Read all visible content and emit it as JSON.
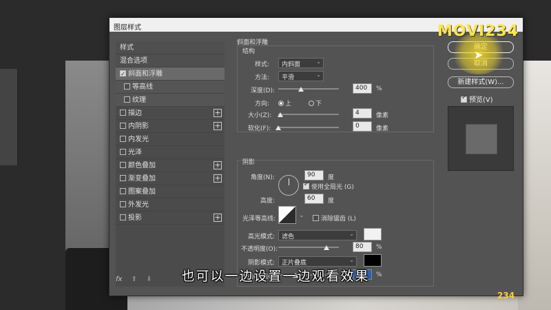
{
  "dialog": {
    "title": "图层样式"
  },
  "style_list": {
    "items": [
      {
        "label": "样式",
        "type": "head"
      },
      {
        "label": "混合选项",
        "type": "head"
      },
      {
        "label": "斜面和浮雕",
        "checked": true,
        "active": true
      },
      {
        "label": "等高线",
        "sub": true
      },
      {
        "label": "纹理",
        "sub": true
      },
      {
        "label": "描边",
        "plus": true
      },
      {
        "label": "内阴影",
        "plus": true
      },
      {
        "label": "内发光"
      },
      {
        "label": "光泽"
      },
      {
        "label": "颜色叠加",
        "plus": true
      },
      {
        "label": "渐变叠加",
        "plus": true
      },
      {
        "label": "图案叠加"
      },
      {
        "label": "外发光"
      },
      {
        "label": "投影",
        "plus": true
      }
    ],
    "footer": {
      "fx": "fx",
      "up": "⬆",
      "down": "⬇",
      "trash": "🗑"
    }
  },
  "bevel": {
    "section_title": "斜面和浮雕",
    "structure_title": "结构",
    "style_label": "样式:",
    "style_value": "内斜面",
    "technique_label": "方法:",
    "technique_value": "平滑",
    "depth_label": "深度(D):",
    "depth_value": "400",
    "depth_unit": "%",
    "depth_level": 0.35,
    "direction_label": "方向:",
    "direction_up": "上",
    "direction_down": "下",
    "size_label": "大小(Z):",
    "size_value": "4",
    "size_unit": "像素",
    "soften_label": "软化(F):",
    "soften_value": "0",
    "soften_unit": "像素"
  },
  "shading": {
    "title": "阴影",
    "angle_label": "角度(N):",
    "angle_value": "90",
    "angle_unit": "度",
    "global_light_label": "使用全局光 (G)",
    "altitude_label": "高度:",
    "altitude_value": "60",
    "altitude_unit": "度",
    "gloss_contour_label": "光泽等高线:",
    "anti_alias_label": "消除锯齿 (L)",
    "highlight_mode_label": "高光模式:",
    "highlight_mode_value": "滤色",
    "highlight_opacity_label": "不透明度(O):",
    "highlight_opacity_value": "80",
    "highlight_opacity_unit": "%",
    "shadow_mode_label": "阴影模式:",
    "shadow_mode_value": "正片叠底",
    "shadow_opacity_label": "不透明度(C):",
    "shadow_opacity_value": "28",
    "shadow_opacity_unit": "%",
    "highlight_color": "#f2f2f2",
    "shadow_color": "#000000"
  },
  "buttons": {
    "ok": "确定",
    "cancel": "取消",
    "new_style": "新建样式(W)...",
    "preview": "预览(V)"
  },
  "logo": {
    "text": "MOVI234",
    "small": "234"
  },
  "subtitle": "也可以一边设置一边观看效果"
}
